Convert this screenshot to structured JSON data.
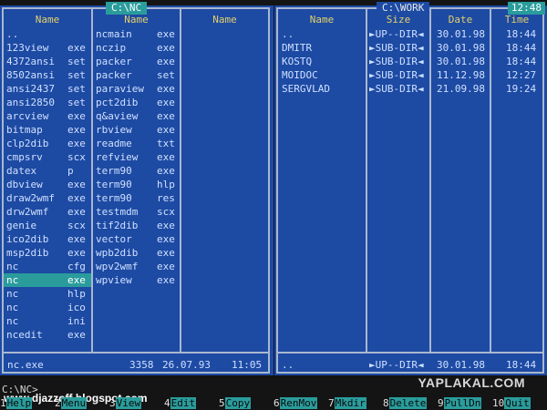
{
  "left_panel": {
    "title": "C:\\NC",
    "column_headers": [
      "Name",
      "Name",
      "Name"
    ],
    "columns": [
      [
        {
          "name": "..",
          "ext": ""
        },
        {
          "name": "123view",
          "ext": "exe"
        },
        {
          "name": "4372ansi",
          "ext": "set"
        },
        {
          "name": "8502ansi",
          "ext": "set"
        },
        {
          "name": "ansi2437",
          "ext": "set"
        },
        {
          "name": "ansi2850",
          "ext": "set"
        },
        {
          "name": "arcview",
          "ext": "exe"
        },
        {
          "name": "bitmap",
          "ext": "exe"
        },
        {
          "name": "clp2dib",
          "ext": "exe"
        },
        {
          "name": "cmpsrv",
          "ext": "scx"
        },
        {
          "name": "datex",
          "ext": "p"
        },
        {
          "name": "dbview",
          "ext": "exe"
        },
        {
          "name": "draw2wmf",
          "ext": "exe"
        },
        {
          "name": "drw2wmf",
          "ext": "exe"
        },
        {
          "name": "genie",
          "ext": "scx"
        },
        {
          "name": "ico2dib",
          "ext": "exe"
        },
        {
          "name": "msp2dib",
          "ext": "exe"
        },
        {
          "name": "nc",
          "ext": "cfg"
        },
        {
          "name": "nc",
          "ext": "exe",
          "selected": true
        },
        {
          "name": "nc",
          "ext": "hlp"
        },
        {
          "name": "nc",
          "ext": "ico"
        },
        {
          "name": "nc",
          "ext": "ini"
        },
        {
          "name": "ncedit",
          "ext": "exe"
        }
      ],
      [
        {
          "name": "ncmain",
          "ext": "exe"
        },
        {
          "name": "nczip",
          "ext": "exe"
        },
        {
          "name": "packer",
          "ext": "exe"
        },
        {
          "name": "packer",
          "ext": "set"
        },
        {
          "name": "paraview",
          "ext": "exe"
        },
        {
          "name": "pct2dib",
          "ext": "exe"
        },
        {
          "name": "q&aview",
          "ext": "exe"
        },
        {
          "name": "rbview",
          "ext": "exe"
        },
        {
          "name": "readme",
          "ext": "txt"
        },
        {
          "name": "refview",
          "ext": "exe"
        },
        {
          "name": "term90",
          "ext": "exe"
        },
        {
          "name": "term90",
          "ext": "hlp"
        },
        {
          "name": "term90",
          "ext": "res"
        },
        {
          "name": "testmdm",
          "ext": "scx"
        },
        {
          "name": "tif2dib",
          "ext": "exe"
        },
        {
          "name": "vector",
          "ext": "exe"
        },
        {
          "name": "wpb2dib",
          "ext": "exe"
        },
        {
          "name": "wpv2wmf",
          "ext": "exe"
        },
        {
          "name": "wpview",
          "ext": "exe"
        }
      ],
      []
    ],
    "info": {
      "name": "nc.exe",
      "size": "3358",
      "date": "26.07.93",
      "time": "11:05"
    }
  },
  "right_panel": {
    "title": "C:\\WORK",
    "clock": "12:48",
    "headers": {
      "name": "Name",
      "size": "Size",
      "date": "Date",
      "time": "Time"
    },
    "rows": [
      {
        "name": "..",
        "size": "►UP--DIR◄",
        "date": "30.01.98",
        "time": "18:44"
      },
      {
        "name": "DMITR",
        "size": "►SUB-DIR◄",
        "date": "30.01.98",
        "time": "18:44"
      },
      {
        "name": "KOSTQ",
        "size": "►SUB-DIR◄",
        "date": "30.01.98",
        "time": "18:44"
      },
      {
        "name": "MOIDOC",
        "size": "►SUB-DIR◄",
        "date": "11.12.98",
        "time": "12:27"
      },
      {
        "name": "SERGVLAD",
        "size": "►SUB-DIR◄",
        "date": "21.09.98",
        "time": "19:24"
      }
    ],
    "info": {
      "name": "..",
      "size": "►UP--DIR◄",
      "date": "30.01.98",
      "time": "18:44"
    }
  },
  "command_line": "C:\\NC>",
  "watermark": "www.djazzoff.blogspot.com",
  "site_logo": "YAPLAKAL.COM",
  "keybar": [
    {
      "num": "1",
      "label": "Help"
    },
    {
      "num": "2",
      "label": "Menu"
    },
    {
      "num": "3",
      "label": "View"
    },
    {
      "num": "4",
      "label": "Edit"
    },
    {
      "num": "5",
      "label": "Copy"
    },
    {
      "num": "6",
      "label": "RenMov"
    },
    {
      "num": "7",
      "label": "Mkdir"
    },
    {
      "num": "8",
      "label": "Delete"
    },
    {
      "num": "9",
      "label": "PullDn"
    },
    {
      "num": "10",
      "label": "Quit"
    }
  ],
  "colors": {
    "panel_bg": "#1d4aa3",
    "highlight": "#2a9c9c",
    "header_text": "#e2d16b"
  }
}
